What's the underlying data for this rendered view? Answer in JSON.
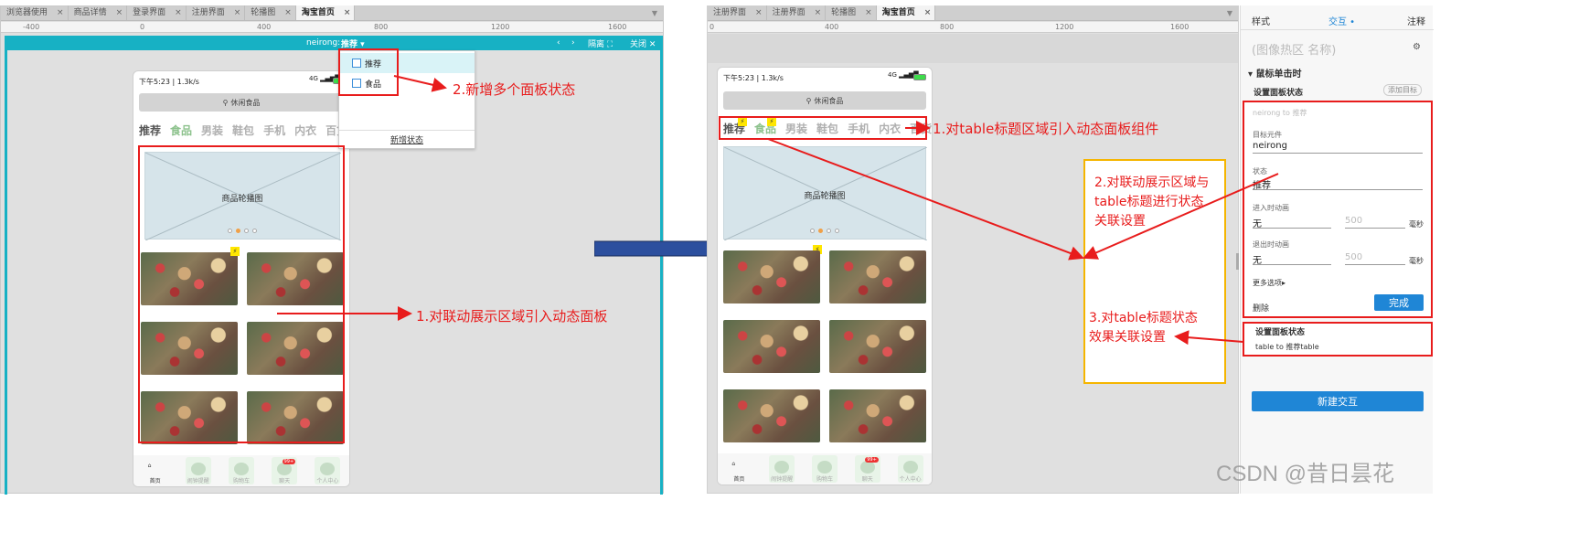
{
  "left": {
    "tabs": [
      {
        "label": "浏览器使用",
        "active": false
      },
      {
        "label": "商品详情",
        "active": false
      },
      {
        "label": "登录界面",
        "active": false
      },
      {
        "label": "注册界面",
        "active": false
      },
      {
        "label": "轮播图",
        "active": false
      },
      {
        "label": "淘宝首页",
        "active": true
      }
    ],
    "ruler": [
      "-400",
      "0",
      "400",
      "800",
      "1200",
      "1600"
    ],
    "panel_bar": {
      "name_prefix": "neirong:",
      "state": "推荐",
      "isolate": "隔离",
      "close": "关闭"
    },
    "dropdown": {
      "items": [
        "推荐",
        "食品"
      ],
      "add_state": "新增状态"
    },
    "phone": {
      "status_time": "下午5:23 | 1.3k/s",
      "signal": "4G",
      "search": "休闲食品",
      "categories": [
        "推荐",
        "食品",
        "男装",
        "鞋包",
        "手机",
        "内衣",
        "百货"
      ],
      "carousel_label": "商品轮播图",
      "nav": [
        {
          "label": "首页",
          "icon": "home-icon"
        },
        {
          "label": "闹钟提醒",
          "icon": "alarm-icon"
        },
        {
          "label": "购物车",
          "icon": "cart-icon"
        },
        {
          "label": "聊天",
          "icon": "chat-icon",
          "badge": "99+"
        },
        {
          "label": "个人中心",
          "icon": "user-icon"
        }
      ]
    },
    "annotations": {
      "a1": "1.对联动展示区域引入动态面板",
      "a2": "2.新增多个面板状态"
    }
  },
  "right": {
    "tabs": [
      {
        "label": "注册界面",
        "active": false
      },
      {
        "label": "注册界面",
        "active": false
      },
      {
        "label": "轮播图",
        "active": false
      },
      {
        "label": "淘宝首页",
        "active": true
      }
    ],
    "ruler": [
      "0",
      "400",
      "800",
      "1200",
      "1600"
    ],
    "phone": {
      "status_time": "下午5:23 | 1.3k/s",
      "signal": "4G",
      "search": "休闲食品",
      "categories": [
        "推荐",
        "食品",
        "男装",
        "鞋包",
        "手机",
        "内衣",
        "百货"
      ],
      "carousel_label": "商品轮播图",
      "nav": [
        {
          "label": "首页",
          "icon": "home-icon"
        },
        {
          "label": "闹钟提醒",
          "icon": "alarm-icon"
        },
        {
          "label": "购物车",
          "icon": "cart-icon"
        },
        {
          "label": "聊天",
          "icon": "chat-icon",
          "badge": "99+"
        },
        {
          "label": "个人中心",
          "icon": "user-icon"
        }
      ]
    },
    "annotations": {
      "a1": "1.对table标题区域引入动态面板组件",
      "a2": [
        "2.对联动展示区域与",
        "table标题进行状态",
        "关联设置"
      ],
      "a3": [
        "3.对table标题状态",
        "效果关联设置"
      ]
    }
  },
  "inspector": {
    "tabs": [
      "样式",
      "交互",
      "注释"
    ],
    "active_tab": "交互",
    "hotspot_name": "(图像热区 名称)",
    "event": "鼠标单击时",
    "action_title": "设置面板状态",
    "add_target": "添加目标",
    "action_summary": "neirong to 推荐",
    "target_label": "目标元件",
    "target_value": "neirong",
    "state_label": "状态",
    "state_value": "推荐",
    "enter_label": "进入时动画",
    "enter_value": "无",
    "enter_ms": "500",
    "exit_label": "退出时动画",
    "exit_value": "无",
    "exit_ms": "500",
    "unit": "毫秒",
    "more": "更多选项",
    "delete": "删除",
    "done": "完成",
    "action2_title": "设置面板状态",
    "action2_summary": "table to 推荐table",
    "new_interaction": "新建交互"
  },
  "watermark": "CSDN @昔日昙花",
  "colors": {
    "annotation": "#e81c1c",
    "teal": "#17b1c4",
    "blue": "#1f86d6",
    "arrow": "#2c4f9e"
  }
}
